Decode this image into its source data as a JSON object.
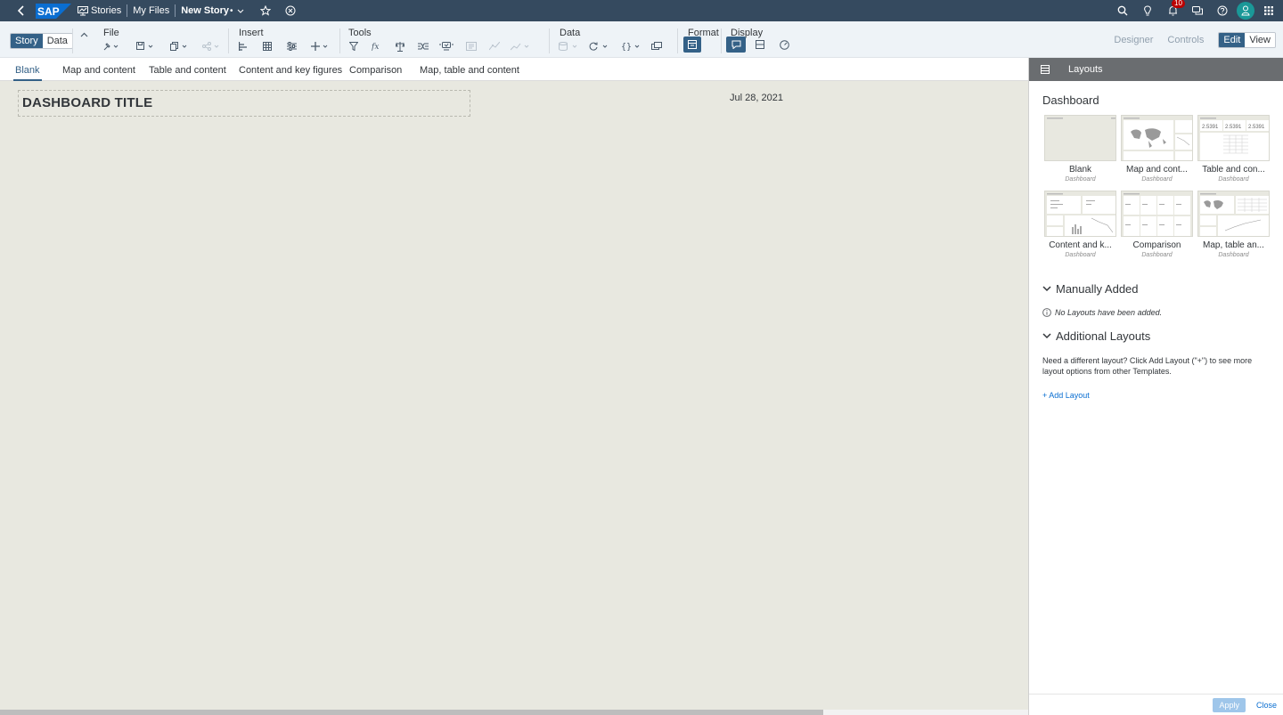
{
  "shell": {
    "logo": "SAP",
    "stories": "Stories",
    "my_files": "My Files",
    "story_name": "New Story",
    "dirty_marker": "•",
    "notification_count": "10",
    "icons": [
      "back-icon",
      "stories-icon",
      "chevron-down-icon",
      "star-icon",
      "close-circle-icon",
      "search-icon",
      "lightbulb-icon",
      "bell-icon",
      "chat-icon",
      "help-icon",
      "user-icon",
      "apps-grid-icon"
    ]
  },
  "toolbar": {
    "story_tab": "Story",
    "data_tab": "Data",
    "groups": {
      "file": "File",
      "insert": "Insert",
      "tools": "Tools",
      "data": "Data",
      "format": "Format",
      "display": "Display"
    },
    "designer": "Designer",
    "controls": "Controls",
    "edit": "Edit",
    "view": "View"
  },
  "tabs": [
    "Blank",
    "Map and content",
    "Table and content",
    "Content and key figures",
    "Comparison",
    "Map, table and content"
  ],
  "canvas": {
    "title": "DASHBOARD TITLE",
    "date": "Jul 28, 2021"
  },
  "panel": {
    "title": "Layouts",
    "section": "Dashboard",
    "layouts": [
      {
        "name": "Blank",
        "sub": "Dashboard"
      },
      {
        "name": "Map and cont...",
        "sub": "Dashboard"
      },
      {
        "name": "Table and con...",
        "sub": "Dashboard"
      },
      {
        "name": "Content and k...",
        "sub": "Dashboard"
      },
      {
        "name": "Comparison",
        "sub": "Dashboard"
      },
      {
        "name": "Map, table an...",
        "sub": "Dashboard"
      }
    ],
    "kpi_sample": "2.5391",
    "manually_added": "Manually Added",
    "no_layouts": "No Layouts have been added.",
    "additional_layouts": "Additional Layouts",
    "additional_text": "Need a different layout? Click Add Layout (\"+\") to see more layout options from other Templates.",
    "add_layout": "+ Add Layout",
    "apply": "Apply",
    "close": "Close"
  },
  "colors": {
    "shell": "#354a5f",
    "accent": "#346187",
    "canvas": "#e8e8e0",
    "link": "#0a6ed1"
  }
}
